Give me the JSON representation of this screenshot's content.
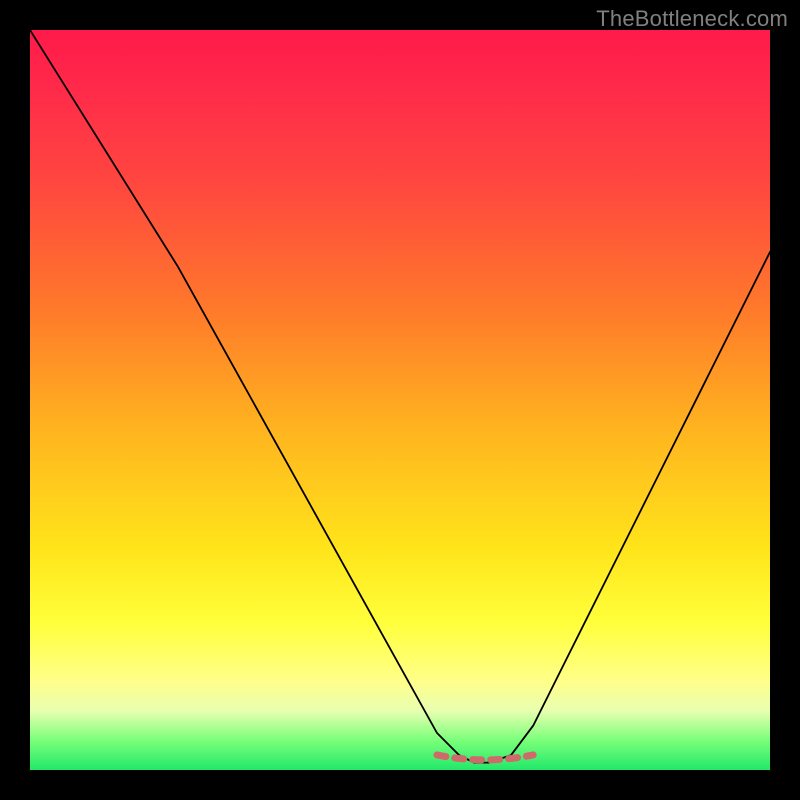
{
  "watermark": "TheBottleneck.com",
  "colors": {
    "gradient_top": "#ff1a4a",
    "gradient_mid": "#ffe41a",
    "gradient_bottom": "#22e86a",
    "curve": "#000000",
    "dashed_segment": "#d06a6a",
    "frame": "#000000"
  },
  "chart_data": {
    "type": "line",
    "title": "",
    "xlabel": "",
    "ylabel": "",
    "xlim": [
      0,
      100
    ],
    "ylim": [
      0,
      100
    ],
    "series": [
      {
        "name": "bottleneck-curve",
        "x": [
          0,
          5,
          10,
          15,
          20,
          25,
          30,
          35,
          40,
          45,
          50,
          55,
          58,
          60,
          62,
          65,
          68,
          72,
          78,
          85,
          92,
          100
        ],
        "y": [
          100,
          92,
          84,
          76,
          68,
          59,
          50,
          41,
          32,
          23,
          14,
          5,
          2,
          1,
          1,
          2,
          6,
          14,
          26,
          40,
          54,
          70
        ]
      }
    ],
    "annotations": [
      {
        "name": "optimal-zone-dashed",
        "x_range": [
          55,
          68
        ],
        "y_level": 1,
        "style": "dashed",
        "color": "#d06a6a"
      }
    ],
    "background_gradient": {
      "direction": "vertical",
      "stops": [
        {
          "pos": 0.0,
          "color": "#ff1a4a"
        },
        {
          "pos": 0.38,
          "color": "#ff7a2a"
        },
        {
          "pos": 0.7,
          "color": "#ffe41a"
        },
        {
          "pos": 0.92,
          "color": "#e8ffb0"
        },
        {
          "pos": 1.0,
          "color": "#22e86a"
        }
      ]
    }
  }
}
